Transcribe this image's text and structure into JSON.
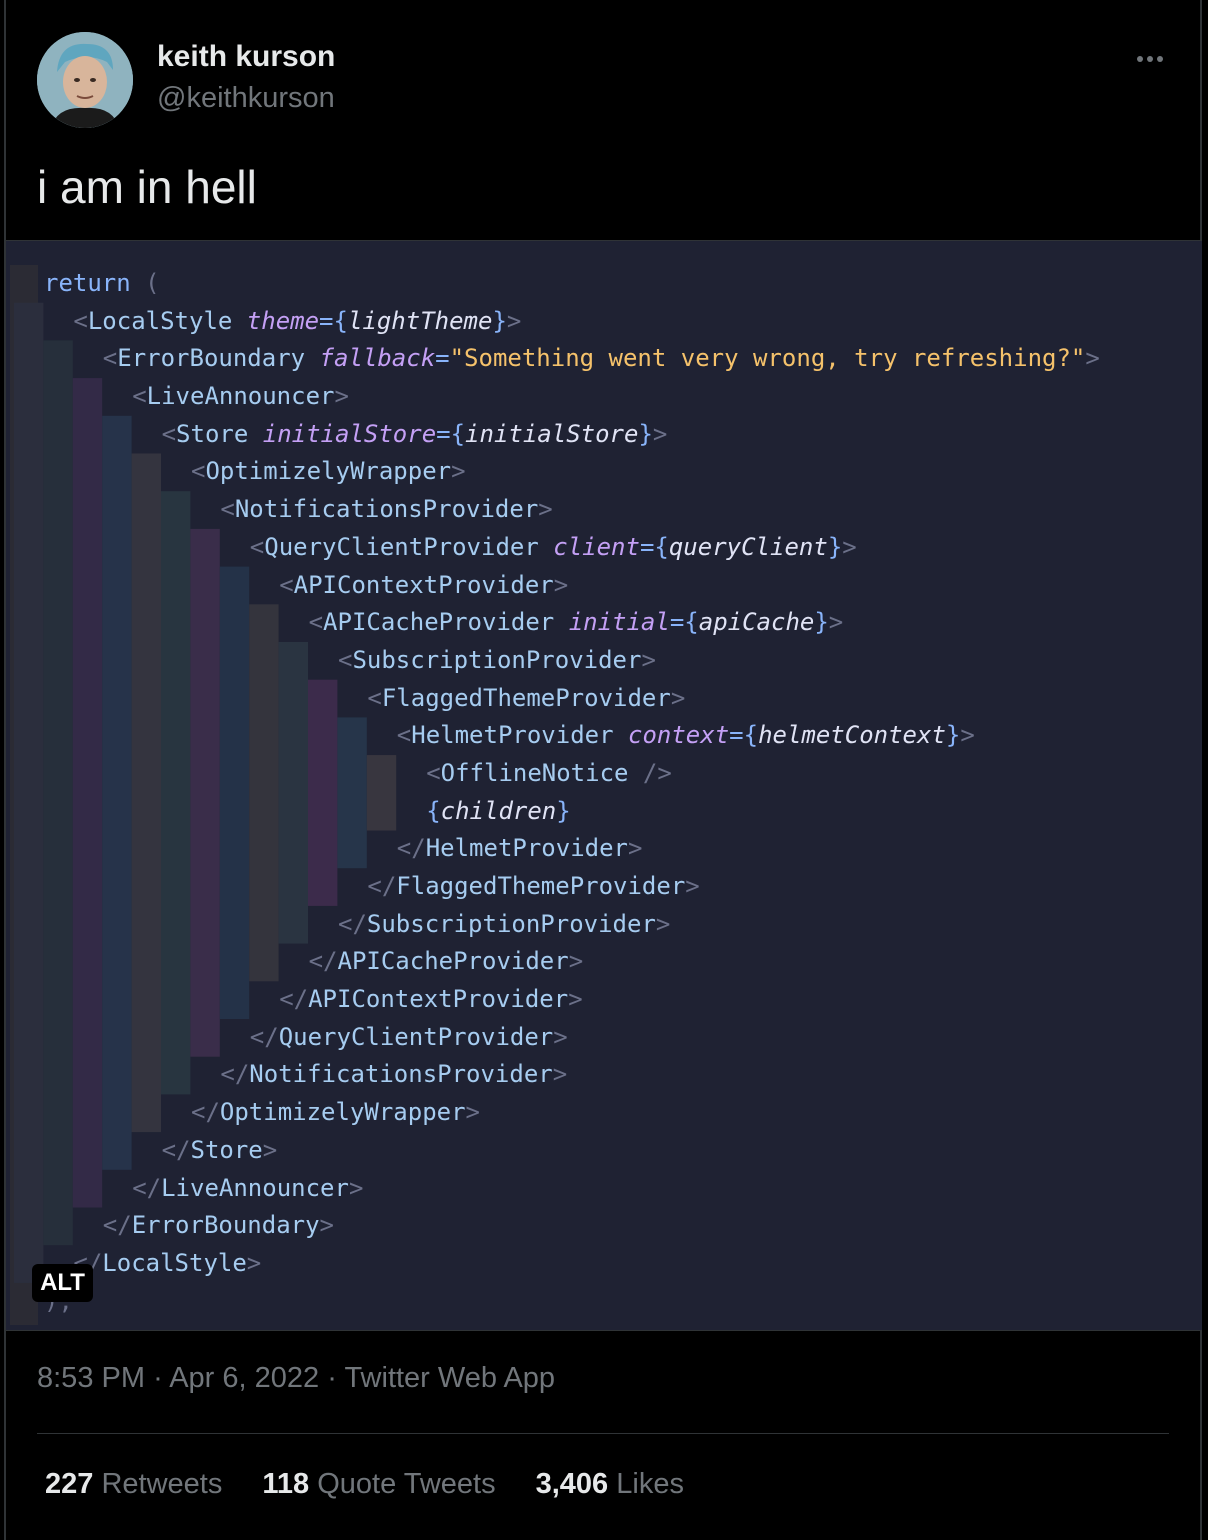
{
  "author": {
    "name": "keith kurson",
    "handle": "@keithkurson"
  },
  "tweet_text": "i am in hell",
  "media": {
    "alt_badge": "ALT",
    "code_lines": [
      {
        "indent": 0,
        "tokens": [
          [
            "kw",
            "return"
          ],
          [
            "punc",
            " ("
          ]
        ]
      },
      {
        "indent": 1,
        "tokens": [
          [
            "punc",
            "<"
          ],
          [
            "tag",
            "LocalStyle"
          ],
          [
            "punc",
            " "
          ],
          [
            "attr",
            "theme"
          ],
          [
            "eq",
            "={"
          ],
          [
            "expr",
            "lightTheme"
          ],
          [
            "eq",
            "}"
          ],
          [
            "punc",
            ">"
          ]
        ]
      },
      {
        "indent": 2,
        "tokens": [
          [
            "punc",
            "<"
          ],
          [
            "tag",
            "ErrorBoundary"
          ],
          [
            "punc",
            " "
          ],
          [
            "attr",
            "fallback"
          ],
          [
            "eq",
            "="
          ],
          [
            "str",
            "\"Something went very wrong, try refreshing?\""
          ],
          [
            "punc",
            ">"
          ]
        ]
      },
      {
        "indent": 3,
        "tokens": [
          [
            "punc",
            "<"
          ],
          [
            "tag",
            "LiveAnnouncer"
          ],
          [
            "punc",
            ">"
          ]
        ]
      },
      {
        "indent": 4,
        "tokens": [
          [
            "punc",
            "<"
          ],
          [
            "tag",
            "Store"
          ],
          [
            "punc",
            " "
          ],
          [
            "attr",
            "initialStore"
          ],
          [
            "eq",
            "={"
          ],
          [
            "expr",
            "initialStore"
          ],
          [
            "eq",
            "}"
          ],
          [
            "punc",
            ">"
          ]
        ]
      },
      {
        "indent": 5,
        "tokens": [
          [
            "punc",
            "<"
          ],
          [
            "tag",
            "OptimizelyWrapper"
          ],
          [
            "punc",
            ">"
          ]
        ]
      },
      {
        "indent": 6,
        "tokens": [
          [
            "punc",
            "<"
          ],
          [
            "tag",
            "NotificationsProvider"
          ],
          [
            "punc",
            ">"
          ]
        ]
      },
      {
        "indent": 7,
        "tokens": [
          [
            "punc",
            "<"
          ],
          [
            "tag",
            "QueryClientProvider"
          ],
          [
            "punc",
            " "
          ],
          [
            "attr",
            "client"
          ],
          [
            "eq",
            "={"
          ],
          [
            "expr",
            "queryClient"
          ],
          [
            "eq",
            "}"
          ],
          [
            "punc",
            ">"
          ]
        ]
      },
      {
        "indent": 8,
        "tokens": [
          [
            "punc",
            "<"
          ],
          [
            "tag",
            "APIContextProvider"
          ],
          [
            "punc",
            ">"
          ]
        ]
      },
      {
        "indent": 9,
        "tokens": [
          [
            "punc",
            "<"
          ],
          [
            "tag",
            "APICacheProvider"
          ],
          [
            "punc",
            " "
          ],
          [
            "attr",
            "initial"
          ],
          [
            "eq",
            "={"
          ],
          [
            "expr",
            "apiCache"
          ],
          [
            "eq",
            "}"
          ],
          [
            "punc",
            ">"
          ]
        ]
      },
      {
        "indent": 10,
        "tokens": [
          [
            "punc",
            "<"
          ],
          [
            "tag",
            "SubscriptionProvider"
          ],
          [
            "punc",
            ">"
          ]
        ]
      },
      {
        "indent": 11,
        "tokens": [
          [
            "punc",
            "<"
          ],
          [
            "tag",
            "FlaggedThemeProvider"
          ],
          [
            "punc",
            ">"
          ]
        ]
      },
      {
        "indent": 12,
        "tokens": [
          [
            "punc",
            "<"
          ],
          [
            "tag",
            "HelmetProvider"
          ],
          [
            "punc",
            " "
          ],
          [
            "attr",
            "context"
          ],
          [
            "eq",
            "={"
          ],
          [
            "expr",
            "helmetContext"
          ],
          [
            "eq",
            "}"
          ],
          [
            "punc",
            ">"
          ]
        ]
      },
      {
        "indent": 13,
        "tokens": [
          [
            "punc",
            "<"
          ],
          [
            "tag",
            "OfflineNotice"
          ],
          [
            "punc",
            " />"
          ]
        ]
      },
      {
        "indent": 13,
        "tokens": [
          [
            "eq",
            "{"
          ],
          [
            "expr",
            "children"
          ],
          [
            "eq",
            "}"
          ]
        ]
      },
      {
        "indent": 12,
        "tokens": [
          [
            "punc",
            "</"
          ],
          [
            "tag",
            "HelmetProvider"
          ],
          [
            "punc",
            ">"
          ]
        ]
      },
      {
        "indent": 11,
        "tokens": [
          [
            "punc",
            "</"
          ],
          [
            "tag",
            "FlaggedThemeProvider"
          ],
          [
            "punc",
            ">"
          ]
        ]
      },
      {
        "indent": 10,
        "tokens": [
          [
            "punc",
            "</"
          ],
          [
            "tag",
            "SubscriptionProvider"
          ],
          [
            "punc",
            ">"
          ]
        ]
      },
      {
        "indent": 9,
        "tokens": [
          [
            "punc",
            "</"
          ],
          [
            "tag",
            "APICacheProvider"
          ],
          [
            "punc",
            ">"
          ]
        ]
      },
      {
        "indent": 8,
        "tokens": [
          [
            "punc",
            "</"
          ],
          [
            "tag",
            "APIContextProvider"
          ],
          [
            "punc",
            ">"
          ]
        ]
      },
      {
        "indent": 7,
        "tokens": [
          [
            "punc",
            "</"
          ],
          [
            "tag",
            "QueryClientProvider"
          ],
          [
            "punc",
            ">"
          ]
        ]
      },
      {
        "indent": 6,
        "tokens": [
          [
            "punc",
            "</"
          ],
          [
            "tag",
            "NotificationsProvider"
          ],
          [
            "punc",
            ">"
          ]
        ]
      },
      {
        "indent": 5,
        "tokens": [
          [
            "punc",
            "</"
          ],
          [
            "tag",
            "OptimizelyWrapper"
          ],
          [
            "punc",
            ">"
          ]
        ]
      },
      {
        "indent": 4,
        "tokens": [
          [
            "punc",
            "</"
          ],
          [
            "tag",
            "Store"
          ],
          [
            "punc",
            ">"
          ]
        ]
      },
      {
        "indent": 3,
        "tokens": [
          [
            "punc",
            "</"
          ],
          [
            "tag",
            "LiveAnnouncer"
          ],
          [
            "punc",
            ">"
          ]
        ]
      },
      {
        "indent": 2,
        "tokens": [
          [
            "punc",
            "</"
          ],
          [
            "tag",
            "ErrorBoundary"
          ],
          [
            "punc",
            ">"
          ]
        ]
      },
      {
        "indent": 1,
        "tokens": [
          [
            "punc",
            "</"
          ],
          [
            "tag",
            "LocalStyle"
          ],
          [
            "punc",
            ">"
          ]
        ]
      },
      {
        "indent": 0,
        "tokens": [
          [
            "punc",
            ");"
          ]
        ]
      }
    ],
    "guide_colors": [
      "#2b2e3d",
      "#262f3b",
      "#332a47",
      "#26334a",
      "#34343f",
      "#283540",
      "#3a2d4a",
      "#243248",
      "#34343d",
      "#2a3441",
      "#3c2b4b",
      "#26354a",
      "#38363f",
      "#2e3644"
    ]
  },
  "meta": {
    "time": "8:53 PM",
    "date": "Apr 6, 2022",
    "source": "Twitter Web App",
    "separator": "·"
  },
  "stats": {
    "retweets_count": "227",
    "retweets_label": "Retweets",
    "quote_count": "118",
    "quote_label": "Quote Tweets",
    "likes_count": "3,406",
    "likes_label": "Likes"
  }
}
